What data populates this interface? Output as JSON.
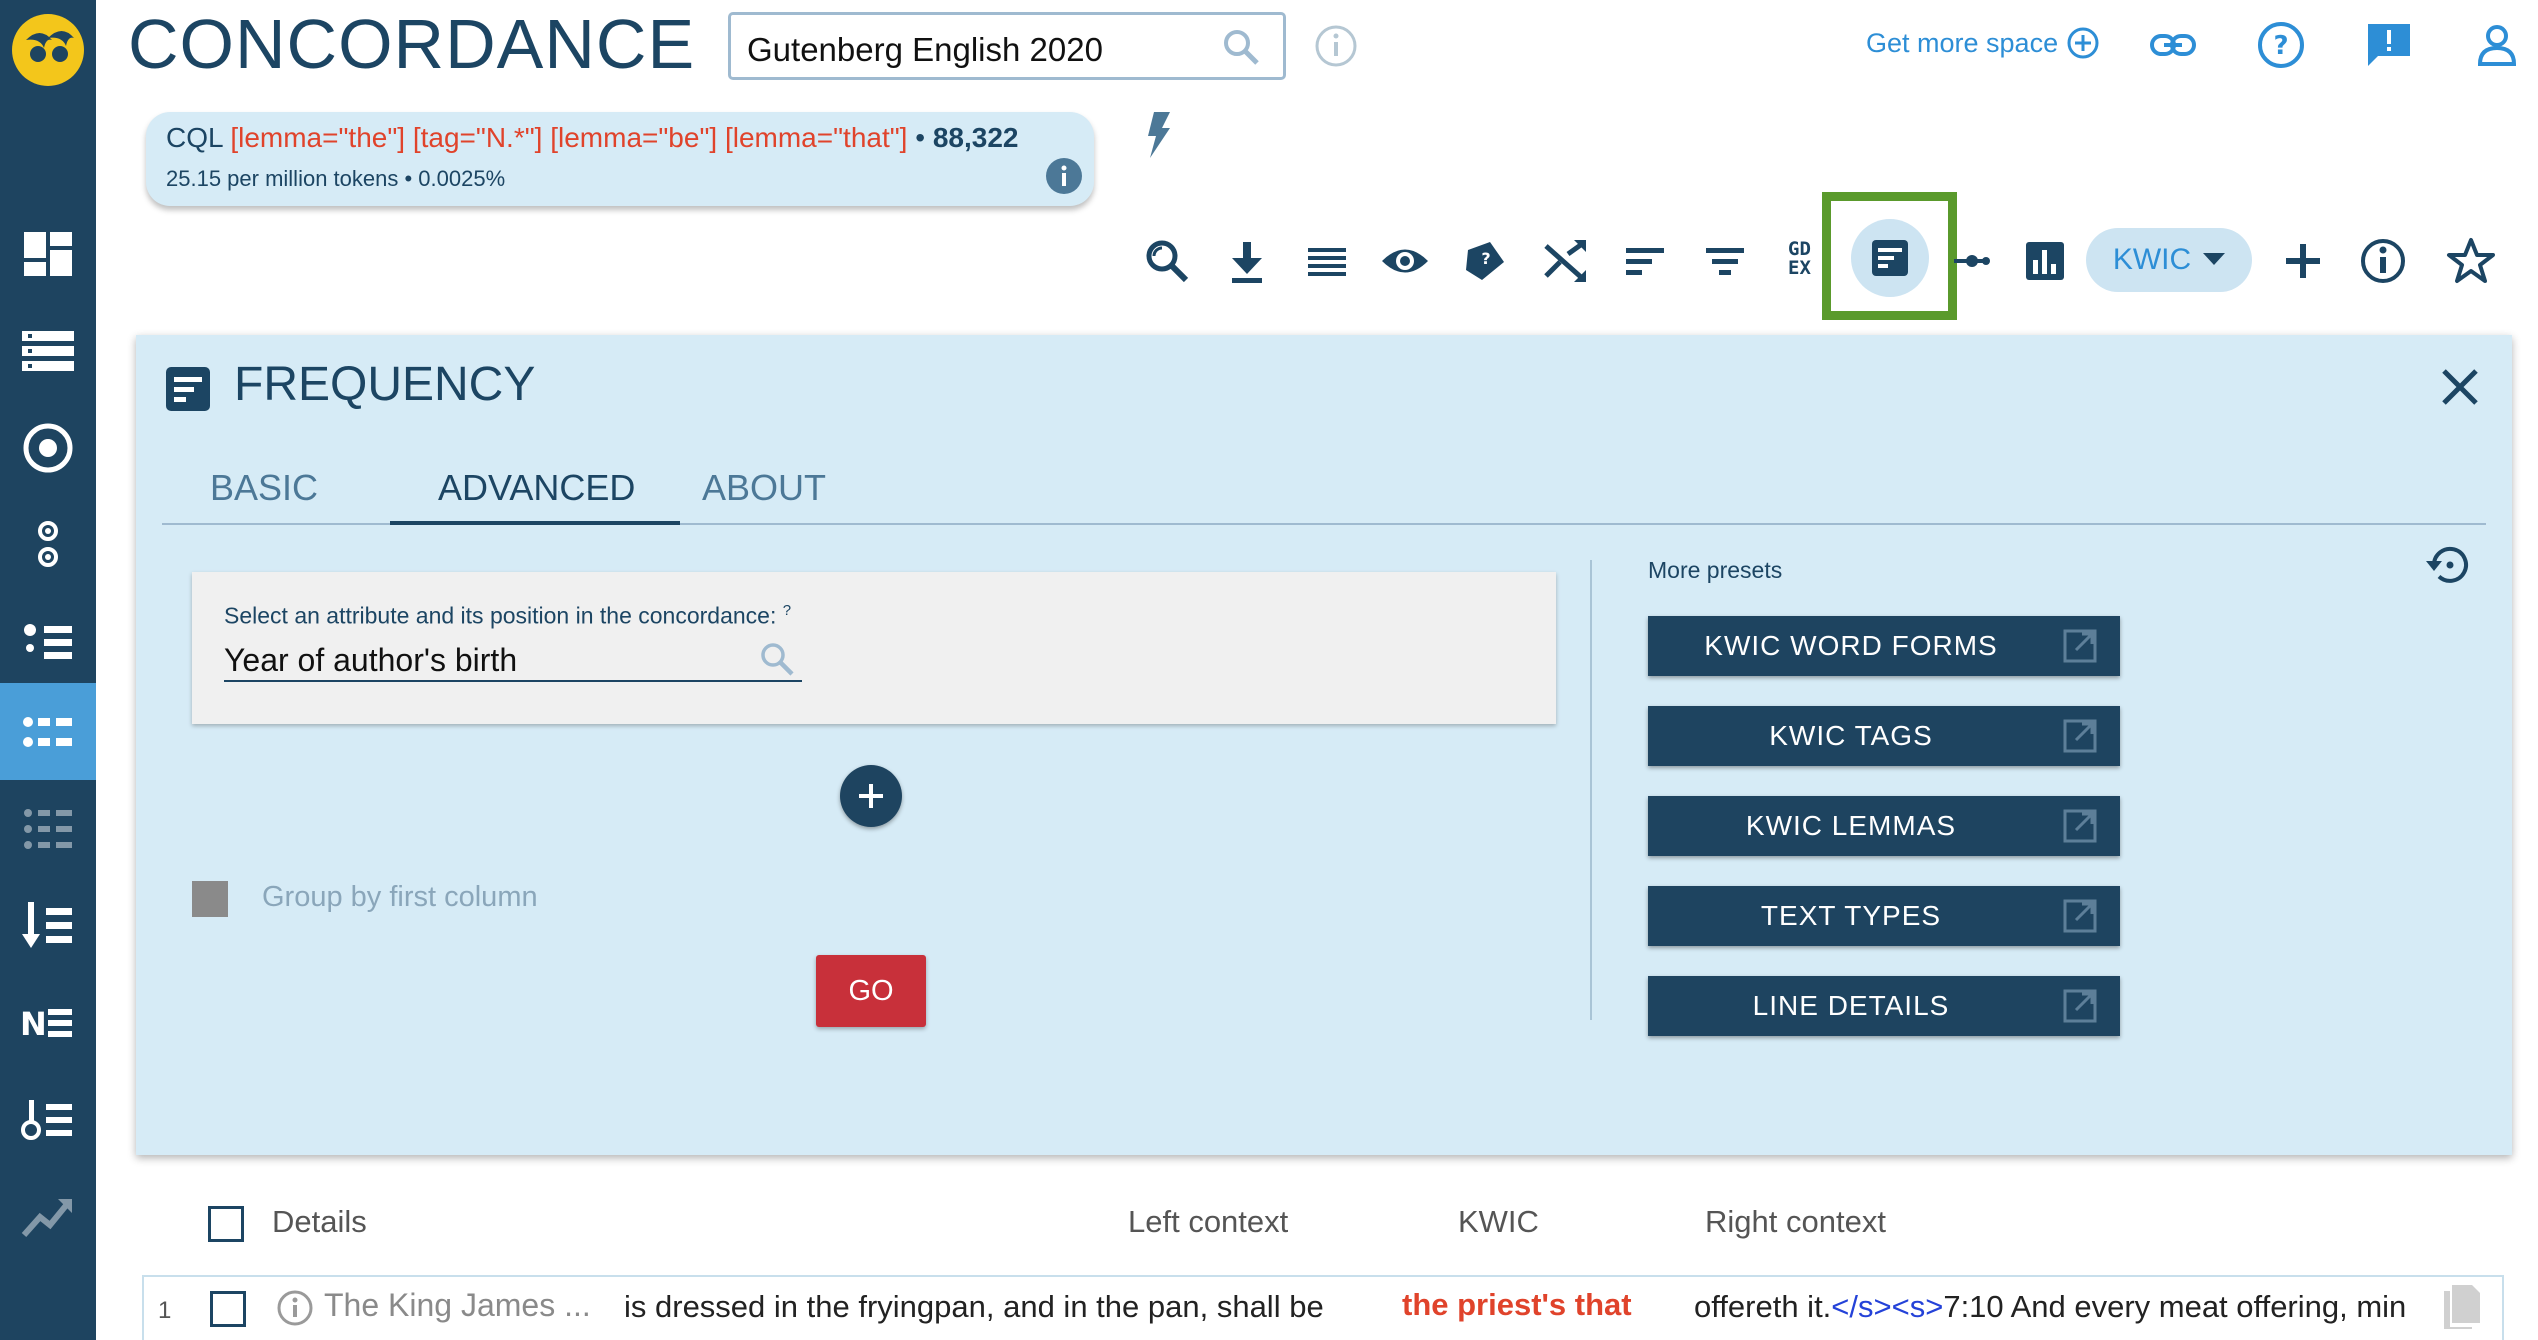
{
  "app": {
    "title": "CONCORDANCE"
  },
  "corpus": {
    "name": "Gutenberg English 2020"
  },
  "header": {
    "more_space": "Get more space"
  },
  "query": {
    "type_label": "CQL",
    "cql": "[lemma=\"the\"] [tag=\"N.*\"] [lemma=\"be\"] [lemma=\"that\"]",
    "hits": "88,322",
    "stats": "25.15 per million tokens • 0.0025%"
  },
  "toolbar": {
    "view_mode": "KWIC",
    "gdex_label_1": "GD",
    "gdex_label_2": "EX",
    "icons": [
      "search-icon",
      "download-icon",
      "lines-icon",
      "eye-icon",
      "sort-icon",
      "shuffle-icon",
      "sort-lines-icon",
      "filter-icon",
      "gdex-icon",
      "frequency-icon",
      "collocations-icon",
      "chart-icon",
      "add-icon",
      "info-icon",
      "star-icon"
    ]
  },
  "sidebar": {
    "items": [
      "dashboard-icon",
      "wordlist-icon",
      "target-icon",
      "ngrams-icon",
      "concordance-icon",
      "frequency-icon",
      "wordsketch-icon",
      "sort-icon",
      "ne-icon",
      "keywords-icon",
      "trends-icon"
    ],
    "active": "frequency-icon"
  },
  "panel": {
    "title": "FREQUENCY",
    "tabs": [
      {
        "label": "BASIC"
      },
      {
        "label": "ADVANCED"
      },
      {
        "label": "ABOUT"
      }
    ],
    "active_tab": "ADVANCED",
    "attribute_label": "Select an attribute and its position in the concordance:",
    "attribute_help": "?",
    "attribute_value": "Year of author's birth",
    "group_label": "Group by first column",
    "go_label": "GO",
    "presets_title": "More presets",
    "presets": [
      {
        "label": "KWIC WORD FORMS"
      },
      {
        "label": "KWIC TAGS"
      },
      {
        "label": "KWIC LEMMAS"
      },
      {
        "label": "TEXT TYPES"
      },
      {
        "label": "LINE DETAILS"
      }
    ]
  },
  "results": {
    "columns": {
      "details": "Details",
      "left": "Left context",
      "kwic": "KWIC",
      "right": "Right context"
    },
    "rows": [
      {
        "num": "1",
        "details": "The King James ...",
        "left": "is dressed in the fryingpan, and in the pan, shall be",
        "kwic": "the priest's that",
        "right_pre": "offereth it.",
        "right_tag": "</s><s>",
        "right_post": "7:10 And every meat offering, min"
      }
    ]
  },
  "colors": {
    "sidebar": "#1e4460",
    "accent": "#2d8ed6",
    "panel": "#d6ebf6",
    "kwic": "#e0432b",
    "go": "#c8303a",
    "highlight": "#5a9a2c"
  }
}
